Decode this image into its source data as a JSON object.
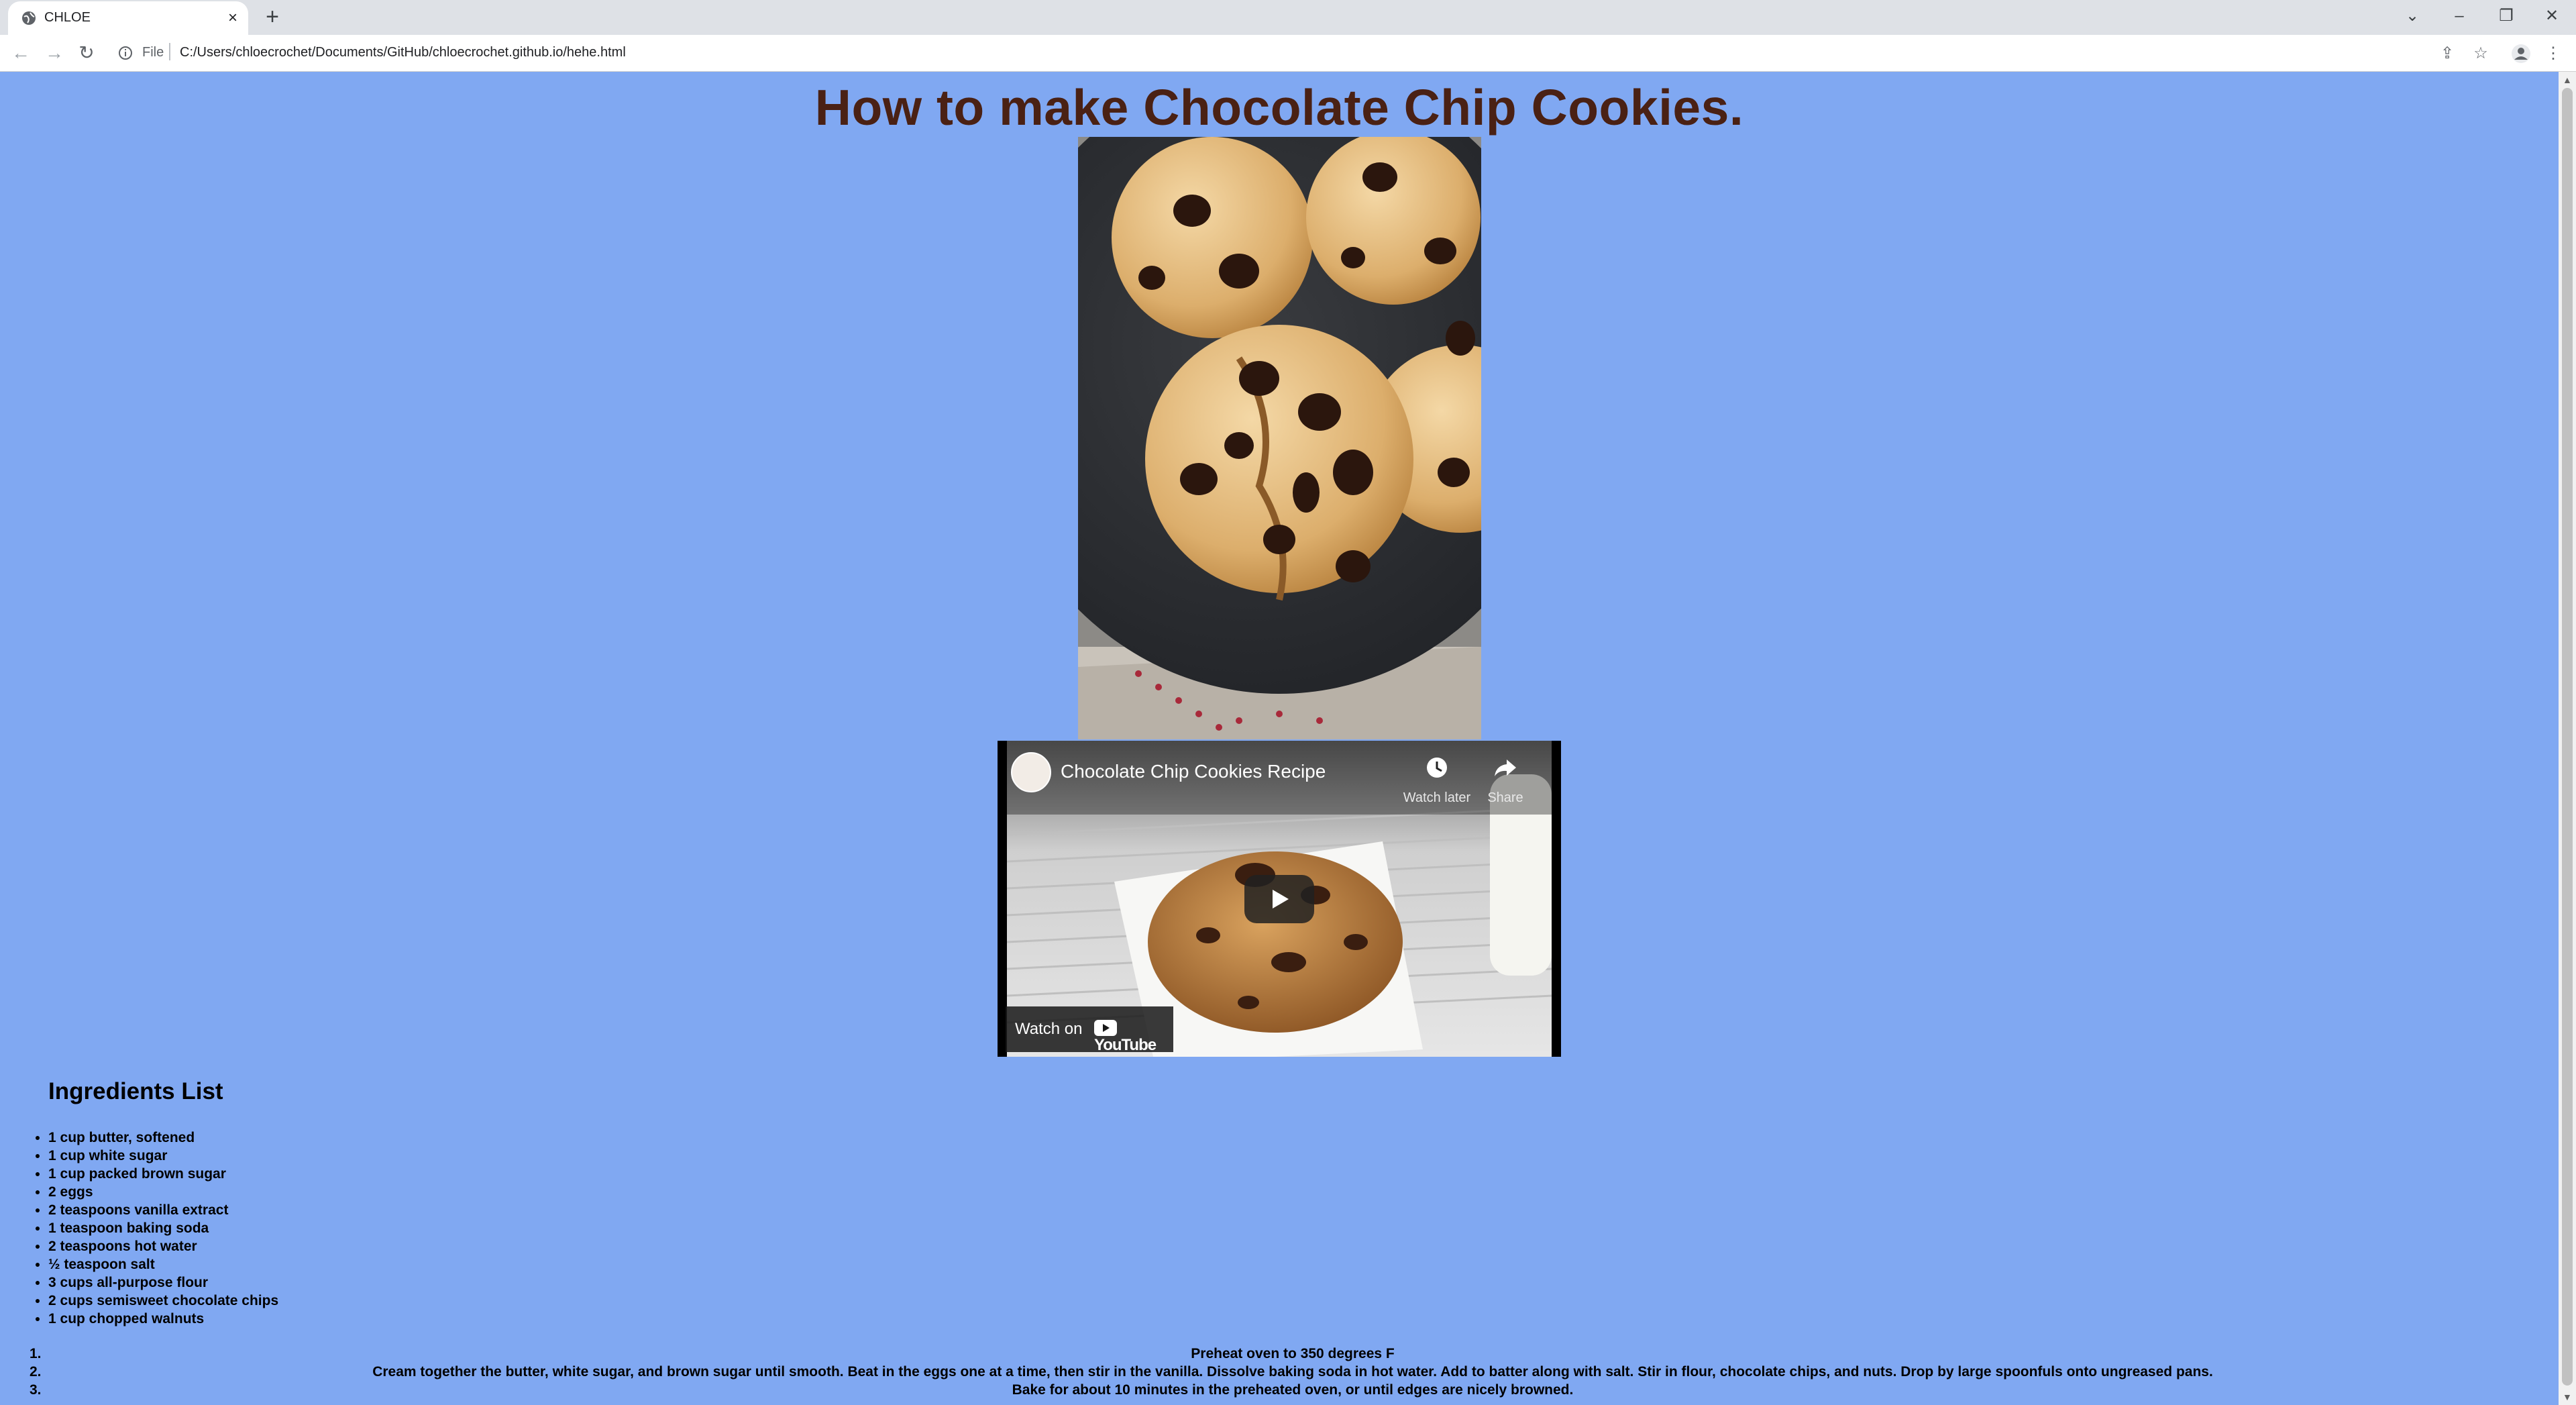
{
  "browser": {
    "tab_title": "CHLOE",
    "url_scheme_label": "File",
    "url": "C:/Users/chloecrochet/Documents/GitHub/chloecrochet.github.io/hehe.html"
  },
  "page": {
    "background_color": "#80a8f2",
    "heading_color": "#4a2114",
    "heading": "How to make Chocolate Chip Cookies.",
    "video": {
      "title": "Chocolate Chip Cookies Recipe",
      "watch_later_label": "Watch later",
      "share_label": "Share",
      "watch_on_label": "Watch on",
      "youtube_wordmark": "YouTube"
    },
    "ingredients_heading": "Ingredients List",
    "ingredients": [
      "1 cup butter, softened",
      "1 cup white sugar",
      "1 cup packed brown sugar",
      "2 eggs",
      "2 teaspoons vanilla extract",
      "1 teaspoon baking soda",
      "2 teaspoons hot water",
      "½ teaspoon salt",
      "3 cups all-purpose flour",
      "2 cups semisweet chocolate chips",
      "1 cup chopped walnuts"
    ],
    "steps": [
      {
        "num": "1.",
        "text": "Preheat oven to 350 degrees F"
      },
      {
        "num": "2.",
        "text": "Cream together the butter, white sugar, and brown sugar until smooth. Beat in the eggs one at a time, then stir in the vanilla. Dissolve baking soda in hot water. Add to batter along with salt. Stir in flour, chocolate chips, and nuts. Drop by large spoonfuls onto ungreased pans."
      },
      {
        "num": "3.",
        "text": "Bake for about 10 minutes in the preheated oven, or until edges are nicely browned."
      }
    ]
  }
}
